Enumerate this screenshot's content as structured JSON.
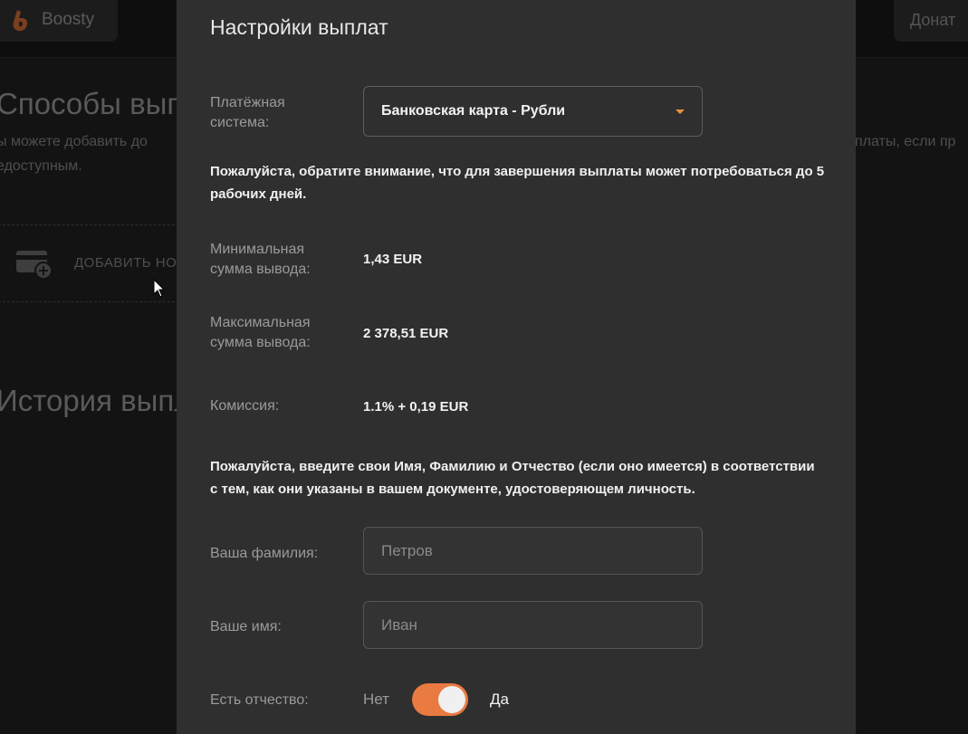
{
  "header": {
    "logo_text": "Boosty",
    "donate_label": "Донат"
  },
  "background": {
    "title": "Способы выпл",
    "text_line1": "ы можете добавить до",
    "text_line2": "едоступным.",
    "text_right": "платы, если пр",
    "add_card_label": "ДОБАВИТЬ НО",
    "history_title": "История выпл"
  },
  "modal": {
    "title": "Настройки выплат",
    "payment_system": {
      "label": "Платёжная система:",
      "value": "Банковская карта - Рубли"
    },
    "notice_days": "Пожалуйста, обратите внимание, что для завершения выплаты может потребоваться до 5 рабочих дней.",
    "min_amount": {
      "label": "Минимальная сумма вывода:",
      "value": "1,43 EUR"
    },
    "max_amount": {
      "label": "Максимальная сумма вывода:",
      "value": "2 378,51 EUR"
    },
    "commission": {
      "label": "Комиссия:",
      "value": "1.1% + 0,19 EUR"
    },
    "notice_name": "Пожалуйста, введите свои Имя, Фамилию и Отчество (если оно имеется) в соответствии с тем, как они указаны в вашем документе, удостоверяющем личность.",
    "surname": {
      "label": "Ваша фамилия:",
      "value": "",
      "placeholder": "Петров"
    },
    "first_name": {
      "label": "Ваше имя:",
      "value": "",
      "placeholder": "Иван"
    },
    "patronymic_toggle": {
      "label": "Есть отчество:",
      "off_label": "Нет",
      "on_label": "Да",
      "checked": true
    }
  },
  "colors": {
    "accent": "#e97a42",
    "caret": "#e8913f",
    "modal_bg": "#2f2f2f"
  },
  "icons": [
    "boosty-logo-icon",
    "add-card-icon",
    "chevron-down-icon",
    "mouse-cursor-icon"
  ]
}
